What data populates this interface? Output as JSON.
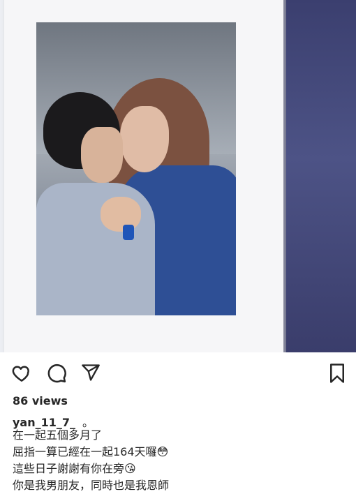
{
  "post": {
    "views": "86 views",
    "username": "yan_11_7_",
    "username_suffix": "。",
    "caption_lines": [
      "在一起五個多月了",
      "屈指一算已經在一起164天囉😳",
      "這些日子謝謝有你在旁😘",
      "你是我男朋友，同時也是我恩師"
    ]
  },
  "icons": {
    "like": "heart-icon",
    "comment": "comment-icon",
    "share": "paper-plane-icon",
    "save": "bookmark-icon"
  }
}
